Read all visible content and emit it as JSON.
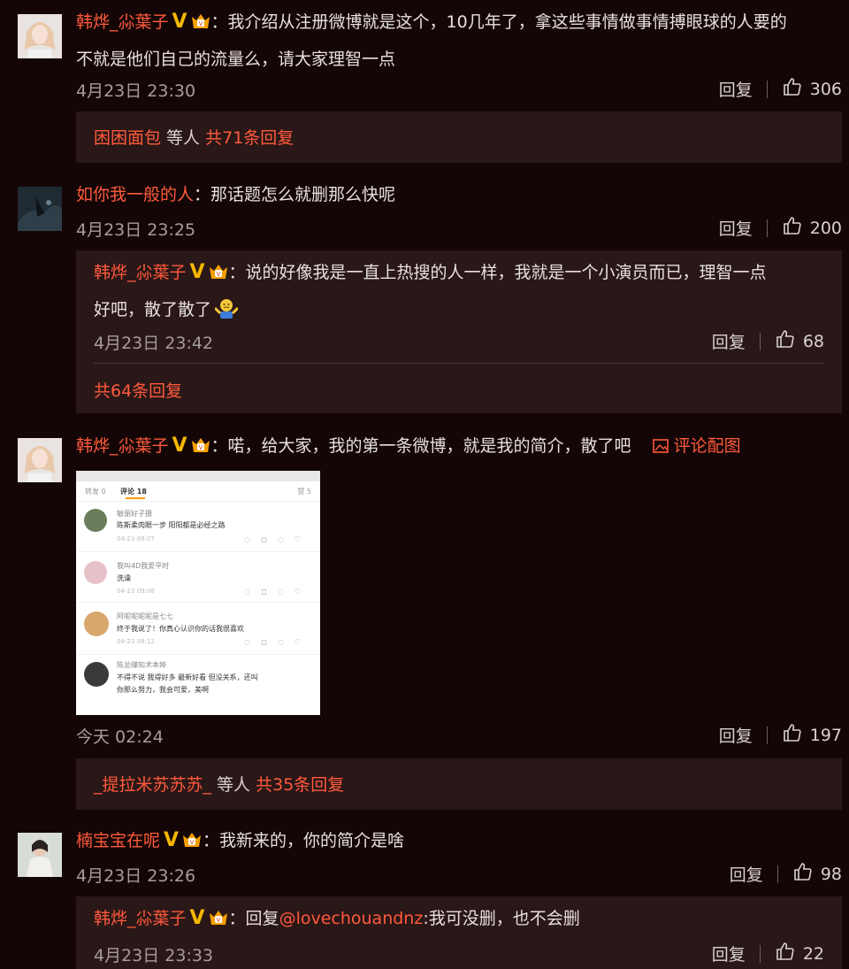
{
  "comments": [
    {
      "user": "韩烨_尛葉子",
      "text_line1": "：我介绍从注册微博就是这个，10几年了，拿这些事情做事情搏眼球的人要的",
      "text_line2": "不就是他们自己的流量么，请大家理智一点",
      "time": "4月23日 23:30",
      "reply_label": "回复",
      "likes": "306",
      "replies_summary": {
        "user": "困困面包",
        "middle": " 等人 ",
        "count": "共71条回复"
      }
    },
    {
      "user": "如你我一般的人",
      "text": "：那话题怎么就删那么快呢",
      "time": "4月23日 23:25",
      "reply_label": "回复",
      "likes": "200",
      "sub_reply": {
        "user": "韩烨_尛葉子",
        "text_line1": "：说的好像我是一直上热搜的人一样，我就是一个小演员而已，理智一点",
        "text_line2": "好吧，散了散了",
        "time": "4月23日 23:42",
        "reply_label": "回复",
        "likes": "68"
      },
      "replies_count": "共64条回复"
    },
    {
      "user": "韩烨_尛葉子",
      "text": "：喏，给大家，我的第一条微博，就是我的简介，散了吧",
      "pic_link": "评论配图",
      "time": "今天 02:24",
      "reply_label": "回复",
      "likes": "197",
      "replies_summary": {
        "user": "_提拉米苏苏苏_",
        "middle": " 等人 ",
        "count": "共35条回复"
      }
    },
    {
      "user": "楠宝宝在呢",
      "text": "：我新来的，你的简介是啥",
      "time": "4月23日 23:26",
      "reply_label": "回复",
      "likes": "98",
      "sub_reply": {
        "user": "韩烨_尛葉子",
        "text_prefix": "：回复",
        "mention": "@lovechouandnz",
        "text_suffix": ":我可没删，也不会删",
        "time": "4月23日 23:33",
        "reply_label": "回复",
        "likes": "22"
      }
    }
  ],
  "embedded_screenshot": {
    "tabs": {
      "left": "转发 0",
      "active": "评论 18",
      "right": "赞 5"
    },
    "rows": [
      {
        "name": "敏丽好子摄",
        "text": "陈斯柔肉眼一步  阳阳都是必经之路",
        "time": "04-23 09:07"
      },
      {
        "name": "我叫4D我爱平时",
        "text": "洗澡",
        "time": "04-23 09:08"
      },
      {
        "name": "阿呢呢呢呢是七七",
        "text": "终于我说了！你真心认识你的话我很喜欢",
        "time": "04-23 09:12"
      },
      {
        "name": "陈总赚知术本婷",
        "text": "不得不说  我得好多  最新好看  但没关系，还叫",
        "text2": "你那么努力，我会可爱，美啊",
        "time": ""
      }
    ]
  },
  "colors": {
    "accent": "#ff5a3c",
    "verified": "#f5b800",
    "background": "#140606"
  }
}
